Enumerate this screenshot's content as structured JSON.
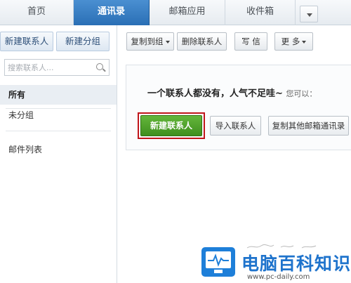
{
  "tabs": [
    {
      "label": "首页",
      "active": false
    },
    {
      "label": "通讯录",
      "active": true
    },
    {
      "label": "邮箱应用",
      "active": false
    },
    {
      "label": "收件箱",
      "active": false
    }
  ],
  "sidebar": {
    "new_contact_label": "新建联系人",
    "new_group_label": "新建分组",
    "search_placeholder": "搜索联系人...",
    "items": [
      {
        "label": "所有",
        "active": true
      },
      {
        "label": "未分组",
        "active": false
      },
      {
        "label": "邮件列表",
        "active": false
      }
    ]
  },
  "toolbar": {
    "copy_to_group": "复制到组",
    "delete_contact": "删除联系人",
    "write": "写 信",
    "more": "更 多"
  },
  "empty_state": {
    "message": "一个联系人都没有，人气不足哇~",
    "hint": "您可以：",
    "new_contact_button": "新建联系人",
    "import_button": "导入联系人",
    "copy_other_button": "复制其他邮箱通讯录"
  },
  "watermark": {
    "brand": "电脑百科知识",
    "url": "www.pc-daily.com"
  },
  "colors": {
    "active_tab": "#2a6fb5",
    "primary_button": "#4fa22b",
    "highlight_border": "#c0161b",
    "watermark_blue": "#1e73cc"
  }
}
